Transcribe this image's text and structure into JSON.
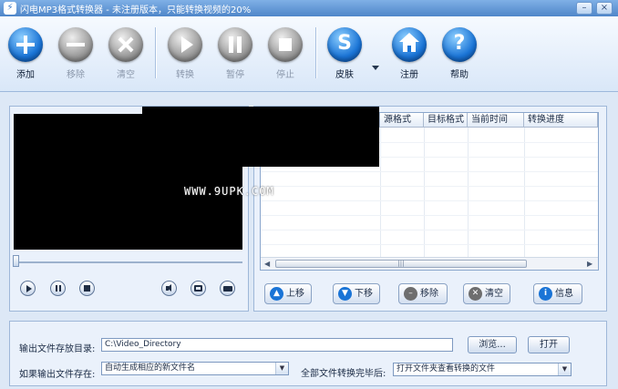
{
  "window": {
    "title": "闪电MP3格式转换器 - 未注册版本，只能转换视频的20%",
    "minimize_glyph": "–",
    "close_glyph": "×"
  },
  "toolbar": {
    "add": "添加",
    "remove": "移除",
    "clear": "清空",
    "convert": "转换",
    "pause": "暂停",
    "stop": "停止",
    "skin": "皮肤",
    "skin_glyph": "S",
    "register": "注册",
    "help": "帮助",
    "help_glyph": "?"
  },
  "file_list": {
    "columns": [
      "源格式",
      "目标格式",
      "当前时间",
      "转换进度"
    ],
    "watermark": "WWW.9UPK.COM"
  },
  "list_buttons": {
    "move_up": "上移",
    "move_down": "下移",
    "remove": "移除",
    "clear": "清空",
    "info": "信息"
  },
  "output": {
    "dir_label": "输出文件存放目录:",
    "dir_value": "C:\\Video_Directory",
    "browse": "浏览...",
    "open": "打开",
    "exists_label": "如果输出文件存在:",
    "exists_value": "自动生成相应的新文件名",
    "after_label": "全部文件转换完毕后:",
    "after_value": "打开文件夹查看转换的文件"
  },
  "colors": {
    "accent_blue": "#1a74d6",
    "disabled_gray": "#9a9a9a",
    "video_bg": "#000000"
  }
}
